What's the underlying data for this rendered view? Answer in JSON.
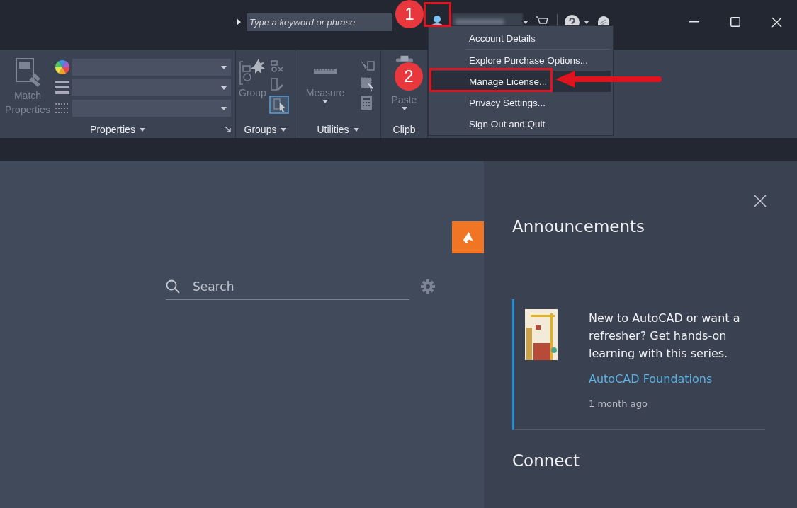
{
  "title_bar": {
    "search": {
      "placeholder": "Type a keyword or phrase"
    }
  },
  "account_menu": {
    "items": [
      {
        "label": "Account Details",
        "selected": false
      },
      {
        "label": "Explore Purchase Options...",
        "selected": false
      },
      {
        "label": "Manage License...",
        "selected": true
      },
      {
        "label": "Privacy Settings...",
        "selected": false
      },
      {
        "label": "Sign Out and Quit",
        "selected": false
      }
    ]
  },
  "annotations": [
    {
      "label": "1"
    },
    {
      "label": "2"
    }
  ],
  "ribbon": {
    "panels": [
      {
        "kind": "properties",
        "title": "Properties",
        "tool": {
          "label": "Match Properties",
          "disabled": true
        }
      },
      {
        "kind": "groups",
        "title": "Groups",
        "tool": {
          "label": "Group",
          "disabled": true
        }
      },
      {
        "kind": "utilities",
        "title": "Utilities",
        "tool": {
          "label": "Measure",
          "disabled": true
        }
      },
      {
        "kind": "clipboard",
        "title": "Clipb",
        "tool": {
          "label": "Paste",
          "disabled": true
        }
      }
    ]
  },
  "start_page": {
    "search": {
      "placeholder": "Search"
    },
    "announcements": {
      "title": "Announcements",
      "items": [
        {
          "text": "New to AutoCAD or want a refresher? Get hands-on learning with this series.",
          "link": "AutoCAD Foundations",
          "time": "1 month ago"
        }
      ]
    },
    "connect": {
      "title": "Connect"
    }
  }
}
